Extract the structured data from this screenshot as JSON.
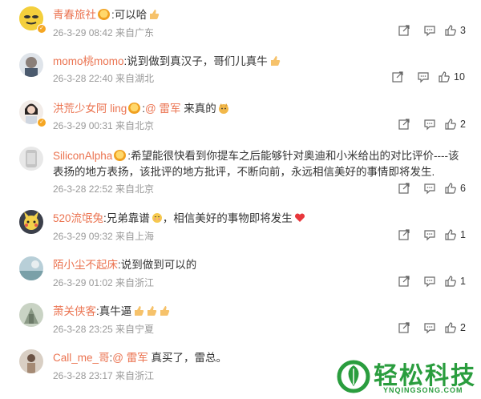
{
  "comments": [
    {
      "user": "青春旅社",
      "sep": ":",
      "text": "可以哈",
      "emoji": "thumb",
      "meta": "26-3-29 08:42 来自广东",
      "likes": "3",
      "verified": true
    },
    {
      "user": "momo桃momo",
      "sep": ":",
      "text": "说到做到真汉子，哥们儿真牛",
      "emoji": "thumb",
      "meta": "26-3-28 22:40 来自湖北",
      "likes": "10",
      "verified": false
    },
    {
      "user": "洪荒少女阿 ling",
      "sep": ":",
      "mention": "@ 雷军",
      "text": " 来真的",
      "emoji": "dog",
      "meta": "26-3-29 00:31 来自北京",
      "likes": "2",
      "verified": true
    },
    {
      "user": "SiliconAlpha",
      "sep": ":",
      "text": "希望能很快看到你提车之后能够针对奥迪和小米给出的对比评价----该表扬的地方表扬，该批评的地方批评，不断向前，永远相信美好的事情即将发生.",
      "meta": "26-3-28 22:52 来自北京",
      "likes": "6",
      "verified": false
    },
    {
      "user": "520流氓兔",
      "sep": ":",
      "text": "兄弟靠谱",
      "emoji2": "face",
      "text2": "，相信美好的事物即将发生",
      "emoji": "heart",
      "meta": "26-3-29 09:32 来自上海",
      "likes": "1",
      "verified": false
    },
    {
      "user": "陌小尘不起床",
      "sep": ":",
      "text": "说到做到可以的",
      "meta": "26-3-29 01:02 来自浙江",
      "likes": "1",
      "verified": false
    },
    {
      "user": "萧关侠客",
      "sep": ":",
      "text": "真牛逼",
      "emoji": "thumb3",
      "meta": "26-3-28 23:25 来自宁夏",
      "likes": "2",
      "verified": false
    },
    {
      "user": "Call_me_哥",
      "sep": ":",
      "mention": "@ 雷军",
      "text": " 真买了，雷总。",
      "meta": "26-3-28 23:17 来自浙江",
      "likes": "",
      "verified": false
    }
  ],
  "watermark": {
    "title": "轻松科技",
    "sub": "YNQINGSONG.COM"
  },
  "colors": {
    "username": "#eb7350",
    "meta": "#999999",
    "watermark": "#2a9d3e"
  },
  "icons": [
    "share-icon",
    "comment-icon",
    "like-icon",
    "medal-icon",
    "verified-badge-icon"
  ]
}
